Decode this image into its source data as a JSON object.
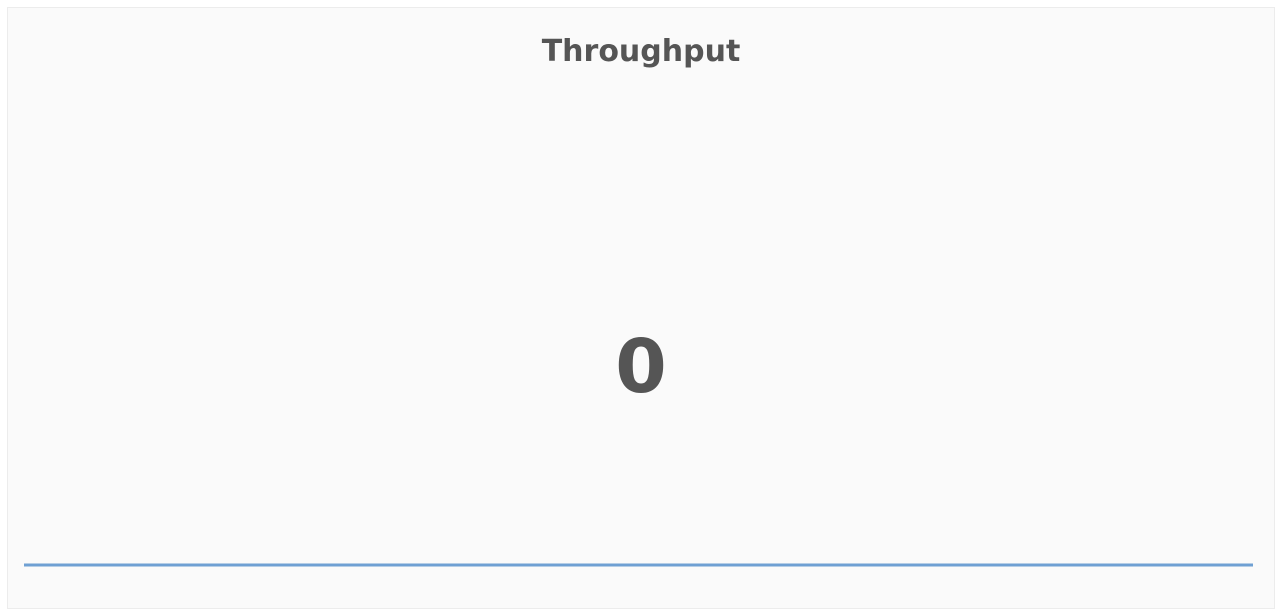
{
  "panel": {
    "title": "Throughput",
    "value": "0",
    "sparkline_color": "#6fa0d3",
    "sparkline_values": [
      0,
      0
    ]
  }
}
